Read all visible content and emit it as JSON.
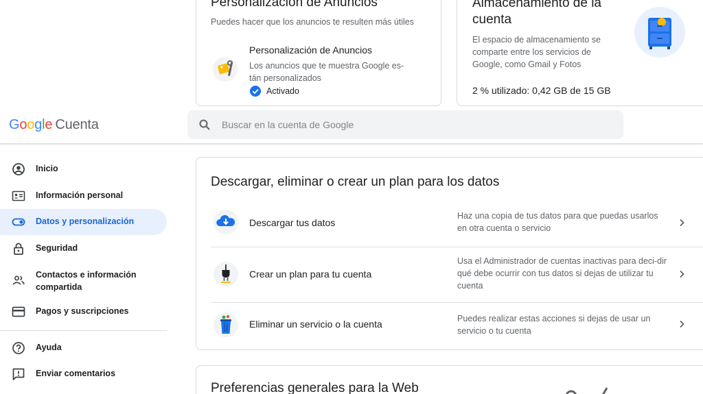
{
  "ads_card": {
    "title": "Personalización de Anuncios",
    "subtitle": "Puedes hacer que los anuncios te resulten más útiles",
    "item_title": "Personalización de Anuncios",
    "item_desc": "Los anuncios que te muestra Google es-tán personalizados",
    "status": "Activado",
    "icon": "ad-tag-wrench-icon"
  },
  "storage_card": {
    "title": "Almacenamiento de la cuenta",
    "desc": "El espacio de almacenamiento se comparte entre los servicios de Google, como Gmail y Fotos",
    "usage": "2 % utilizado: 0,42 GB de 15 GB",
    "icon": "storage-cabinet-icon"
  },
  "header": {
    "logo_google": "Google",
    "logo_product": "Cuenta",
    "search_placeholder": "Buscar en la cuenta de Google"
  },
  "sidebar": {
    "items": [
      {
        "label": "Inicio",
        "icon": "account-circle-icon"
      },
      {
        "label": "Información personal",
        "icon": "id-card-icon"
      },
      {
        "label": "Datos y personalización",
        "icon": "toggle-icon",
        "active": true
      },
      {
        "label": "Seguridad",
        "icon": "lock-icon"
      },
      {
        "label": "Contactos e información compartida",
        "icon": "people-icon"
      },
      {
        "label": "Pagos y suscripciones",
        "icon": "credit-card-icon"
      },
      {
        "label": "Ayuda",
        "icon": "help-icon"
      },
      {
        "label": "Enviar comentarios",
        "icon": "feedback-icon"
      }
    ]
  },
  "data_card": {
    "title": "Descargar, eliminar o crear un plan para los datos",
    "rows": [
      {
        "title": "Descargar tus datos",
        "desc": "Haz una copia de tus datos para que puedas usarlos en otra cuenta o servicio",
        "icon": "cloud-download-icon"
      },
      {
        "title": "Crear un plan para tu cuenta",
        "desc": "Usa el Administrador de cuentas inactivas para deci-dir qué debe ocurrir con tus datos si dejas de utilizar tu cuenta",
        "icon": "plug-icon"
      },
      {
        "title": "Eliminar un servicio o la cuenta",
        "desc": "Puedes realizar estas acciones si dejas de usar un servicio o tu cuenta",
        "icon": "trash-bin-icon"
      }
    ]
  },
  "prefs_card": {
    "title": "Preferencias generales para la Web"
  },
  "colors": {
    "accent": "#1a73e8",
    "active_bg": "#e8f0fe",
    "active_text": "#1967d2",
    "muted_text": "#5f6368",
    "border": "#dadce0"
  }
}
